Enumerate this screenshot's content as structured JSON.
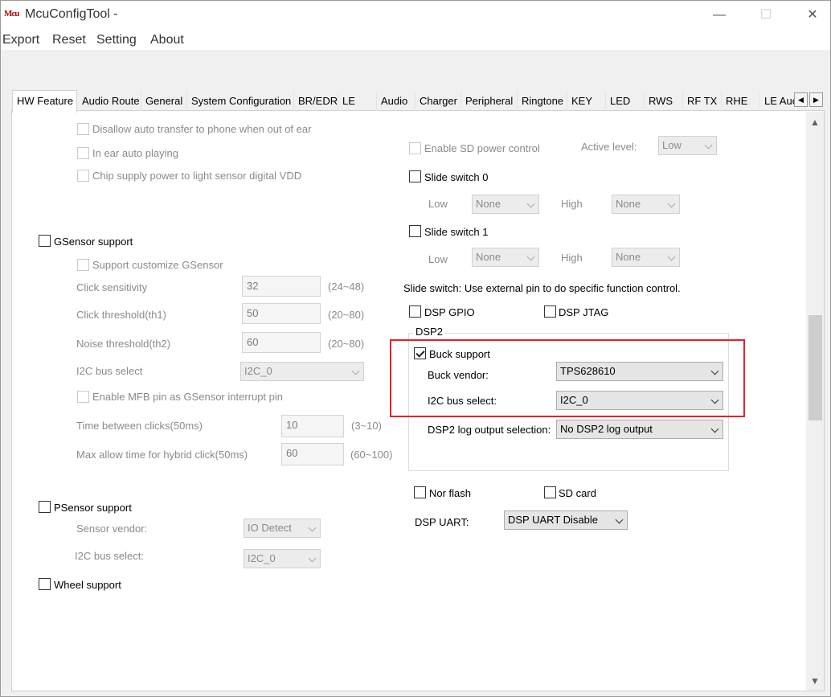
{
  "app": {
    "logo_text": "Mcu",
    "title": "McuConfigTool -"
  },
  "window_controls": {
    "minimize": "—",
    "maximize": "☐",
    "close": "✕"
  },
  "menu": [
    "Export",
    "Reset",
    "Setting",
    "About"
  ],
  "tabs": [
    "HW Feature",
    "Audio Route",
    "General",
    "System Configuration",
    "BR/EDR",
    "LE",
    "Audio",
    "Charger",
    "Peripheral",
    "Ringtone",
    "KEY",
    "LED",
    "RWS",
    "RF TX",
    "RHE",
    "LE Auc"
  ],
  "tab_scroll": {
    "left": "◀",
    "right": "▶"
  },
  "scrollbar": {
    "up": "▲",
    "down": "▼"
  },
  "left": {
    "disallow_auto_transfer": "Disallow auto transfer to phone when out of ear",
    "in_ear_auto_playing": "In ear auto playing",
    "chip_supply_power": "Chip supply power to light sensor digital VDD",
    "gsensor_support": "GSensor support",
    "support_customize_gsensor": "Support customize GSensor",
    "click_sensitivity": {
      "label": "Click sensitivity",
      "value": "32",
      "range": "(24~48)"
    },
    "click_threshold": {
      "label": "Click threshold(th1)",
      "value": "50",
      "range": "(20~80)"
    },
    "noise_threshold": {
      "label": "Noise threshold(th2)",
      "value": "60",
      "range": "(20~80)"
    },
    "i2c_bus_select": {
      "label": "I2C bus select",
      "value": "I2C_0"
    },
    "enable_mfb": "Enable MFB pin as GSensor interrupt pin",
    "time_between_clicks": {
      "label": "Time between clicks(50ms)",
      "value": "10",
      "range": "(3~10)"
    },
    "max_allow_time": {
      "label": "Max allow time for hybrid click(50ms)",
      "value": "60",
      "range": "(60~100)"
    },
    "psensor_support": "PSensor support",
    "sensor_vendor": {
      "label": "Sensor vendor:",
      "value": "IO Detect"
    },
    "psensor_i2c": {
      "label": "I2C bus select:",
      "value": "I2C_0"
    },
    "wheel_support": "Wheel support"
  },
  "right": {
    "enable_sd_power": "Enable SD power control",
    "active_level": {
      "label": "Active level:",
      "value": "Low"
    },
    "slide_switch_0": "Slide switch 0",
    "slide_switch_1": "Slide switch 1",
    "ss0_low": {
      "label": "Low",
      "value": "None"
    },
    "ss0_high": {
      "label": "High",
      "value": "None"
    },
    "ss1_low": {
      "label": "Low",
      "value": "None"
    },
    "ss1_high": {
      "label": "High",
      "value": "None"
    },
    "slide_switch_note": "Slide switch: Use external pin to do specific function control.",
    "dsp_gpio": "DSP GPIO",
    "dsp_jtag": "DSP JTAG",
    "dsp2_group": "DSP2",
    "buck_support": "Buck support",
    "buck_vendor": {
      "label": "Buck vendor:",
      "value": "TPS628610"
    },
    "dsp2_i2c": {
      "label": "I2C bus select:",
      "value": "I2C_0"
    },
    "dsp2_log": {
      "label": "DSP2 log output selection:",
      "value": "No DSP2 log output"
    },
    "nor_flash": "Nor flash",
    "sd_card": "SD card",
    "dsp_uart": {
      "label": "DSP UART:",
      "value": "DSP UART Disable"
    }
  },
  "colors": {
    "highlight_box": "#e8202a",
    "panel_bg": "#f0f0f0"
  }
}
